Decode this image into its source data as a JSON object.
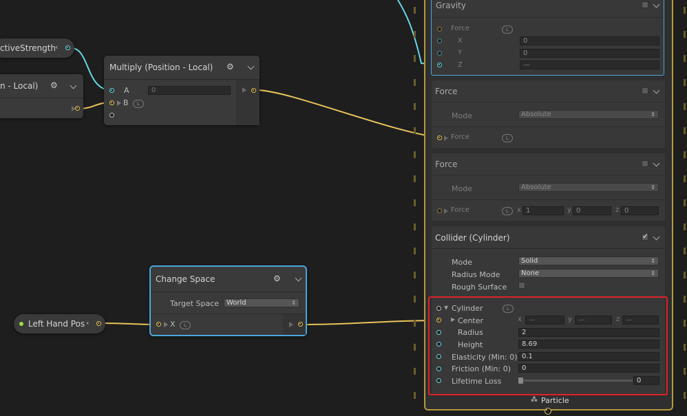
{
  "nodes": {
    "reactive": {
      "title": "ctiveStrength"
    },
    "local": {
      "title": "n - Local)"
    },
    "multiply": {
      "title": "Multiply (Position - Local)",
      "a_label": "A",
      "a_value": "0",
      "b_label": "B"
    },
    "change_space": {
      "title": "Change Space",
      "target_label": "Target Space",
      "target_value": "World",
      "x_label": "X"
    },
    "left_hand": {
      "title": "Left Hand Pos"
    }
  },
  "context": {
    "blocks": {
      "gravity": {
        "title": "Gravity",
        "force_label": "Force",
        "x_label": "X",
        "x_value": "0",
        "y_label": "Y",
        "y_value": "0",
        "z_label": "Z",
        "z_value": "—"
      },
      "force1": {
        "title": "Force",
        "mode_label": "Mode",
        "mode_value": "Absolute",
        "force_label": "Force"
      },
      "force2": {
        "title": "Force",
        "mode_label": "Mode",
        "mode_value": "Absolute",
        "force_label": "Force",
        "x_label": "x",
        "x_value": "1",
        "y_label": "y",
        "y_value": "0",
        "z_label": "z",
        "z_value": "0"
      },
      "collider": {
        "title": "Collider (Cylinder)",
        "mode_label": "Mode",
        "mode_value": "Solid",
        "radius_mode_label": "Radius Mode",
        "radius_mode_value": "None",
        "rough_label": "Rough Surface",
        "cylinder_label": "Cylinder",
        "center_label": "Center",
        "cx_label": "x",
        "cx_value": "—",
        "cy_label": "y",
        "cy_value": "—",
        "cz_label": "z",
        "cz_value": "—",
        "radius_label": "Radius",
        "radius_value": "2",
        "height_label": "Height",
        "height_value": "8.69",
        "elasticity_label": "Elasticity (Min: 0)",
        "elasticity_value": "0.1",
        "friction_label": "Friction (Min: 0)",
        "friction_value": "0",
        "lifetime_label": "Lifetime Loss",
        "lifetime_value": "0"
      }
    },
    "footer": "Particle"
  },
  "colors": {
    "cyan": "#6ad7df",
    "yellow": "#e8c45a",
    "selection": "#4aa8e0",
    "highlight": "#e0202a",
    "context_border": "#b59a3a"
  },
  "badge_text": "L"
}
